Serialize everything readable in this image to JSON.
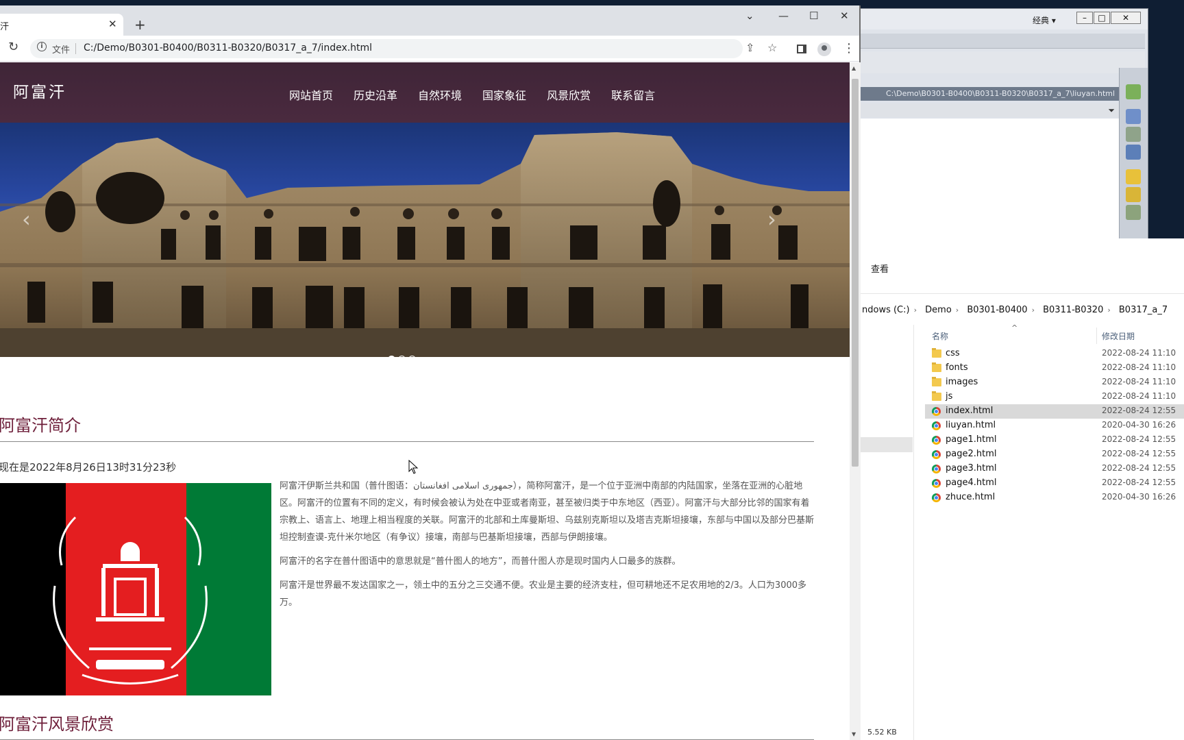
{
  "editor": {
    "menu_label": "经典",
    "path": "C:\\Demo\\B0301-B0400\\B0311-B0320\\B0317_a_7\\liuyan.html"
  },
  "explorer": {
    "ribbon_tab": "查看",
    "breadcrumb": [
      "ndows (C:)",
      "Demo",
      "B0301-B0400",
      "B0311-B0320",
      "B0317_a_7"
    ],
    "col_name": "名称",
    "col_date": "修改日期",
    "files": [
      {
        "name": "css",
        "date": "2022-08-24 11:10",
        "type": "folder"
      },
      {
        "name": "fonts",
        "date": "2022-08-24 11:10",
        "type": "folder"
      },
      {
        "name": "images",
        "date": "2022-08-24 11:10",
        "type": "folder"
      },
      {
        "name": "js",
        "date": "2022-08-24 11:10",
        "type": "folder"
      },
      {
        "name": "index.html",
        "date": "2022-08-24 12:55",
        "type": "html",
        "selected": true
      },
      {
        "name": "liuyan.html",
        "date": "2020-04-30 16:26",
        "type": "html"
      },
      {
        "name": "page1.html",
        "date": "2022-08-24 12:55",
        "type": "html"
      },
      {
        "name": "page2.html",
        "date": "2022-08-24 12:55",
        "type": "html"
      },
      {
        "name": "page3.html",
        "date": "2022-08-24 12:55",
        "type": "html"
      },
      {
        "name": "page4.html",
        "date": "2022-08-24 12:55",
        "type": "html"
      },
      {
        "name": "zhuce.html",
        "date": "2020-04-30 16:26",
        "type": "html"
      }
    ],
    "status": "5.52 KB"
  },
  "browser": {
    "tab_title": "汗",
    "file_label": "文件",
    "url": "C:/Demo/B0301-B0400/B0311-B0320/B0317_a_7/index.html"
  },
  "site": {
    "logo": "阿富汗",
    "nav": [
      "网站首页",
      "历史沿革",
      "自然环境",
      "国家象征",
      "风景欣赏",
      "联系留言"
    ],
    "section1_title": "阿富汗简介",
    "clock": "现在是2022年8月26日13时31分23秒",
    "paragraphs": [
      "阿富汗伊斯兰共和国（普什图语：جمهوری اسلامی افغانستان），简称阿富汗，是一个位于亚洲中南部的内陆国家，坐落在亚洲的心脏地区。阿富汗的位置有不同的定义，有时候会被认为处在中亚或者南亚，甚至被归类于中东地区（西亚）。阿富汗与大部分比邻的国家有着宗教上、语言上、地理上相当程度的关联。阿富汗的北部和土库曼斯坦、乌兹别克斯坦以及塔吉克斯坦接壤，东部与中国以及部分巴基斯坦控制查谟-克什米尔地区（有争议）接壤，南部与巴基斯坦接壤，西部与伊朗接壤。",
      "阿富汗的名字在普什图语中的意思就是“普什图人的地方”，而普什图人亦是现时国内人口最多的族群。",
      "阿富汗是世界最不发达国家之一，领土中的五分之三交通不便。农业是主要的经济支柱，但可耕地还不足农用地的2/3。人口为3000多万。"
    ],
    "section2_title": "阿富汗风景欣赏"
  }
}
